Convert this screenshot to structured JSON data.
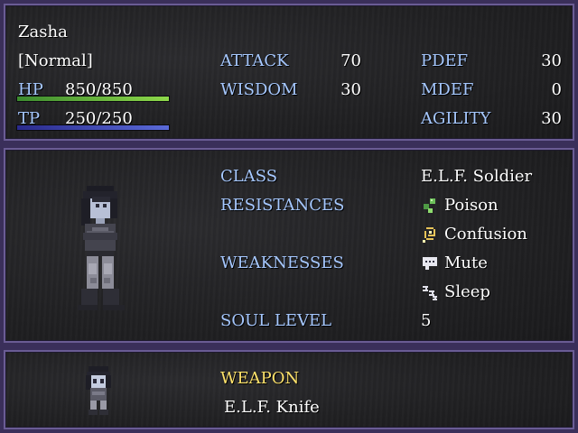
{
  "status": {
    "name": "Zasha",
    "state": "[Normal]",
    "hp_label": "HP",
    "hp_value": "850/850",
    "hp_fraction": 1.0,
    "tp_label": "TP",
    "tp_value": "250/250",
    "tp_fraction": 1.0,
    "stats": [
      {
        "label": "ATTACK",
        "value": "70"
      },
      {
        "label": "WISDOM",
        "value": "30"
      }
    ],
    "defense": [
      {
        "label": "PDEF",
        "value": "30"
      },
      {
        "label": "MDEF",
        "value": "0"
      },
      {
        "label": "AGILITY",
        "value": "30"
      }
    ]
  },
  "profile": {
    "class_label": "CLASS",
    "class_value": "E.L.F. Soldier",
    "resistances_label": "RESISTANCES",
    "resistances": [
      {
        "icon": "poison-icon",
        "label": "Poison"
      },
      {
        "icon": "confusion-icon",
        "label": "Confusion"
      }
    ],
    "weaknesses_label": "WEAKNESSES",
    "weaknesses": [
      {
        "icon": "mute-icon",
        "label": "Mute"
      },
      {
        "icon": "sleep-icon",
        "label": "Sleep"
      }
    ],
    "soul_level_label": "SOUL LEVEL",
    "soul_level_value": "5"
  },
  "equipment": {
    "weapon_label": "WEAPON",
    "weapon_value": "E.L.F. Knife"
  },
  "colors": {
    "label_blue": "#a6c8ff",
    "header_gold": "#ffe36b",
    "hp_gauge": "#8ed84a",
    "tp_gauge": "#5a6ad8",
    "frame": "#6a5c94"
  }
}
